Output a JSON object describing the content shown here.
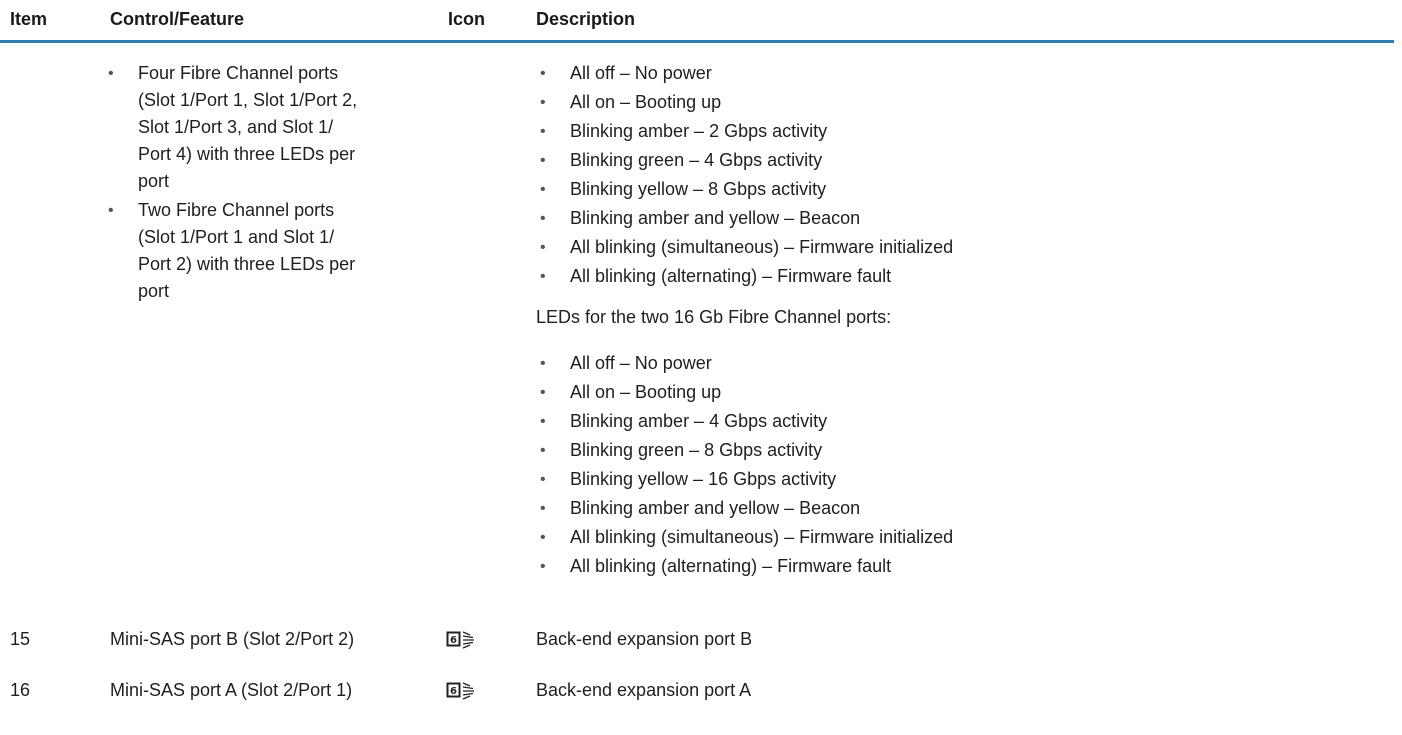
{
  "header": {
    "item": "Item",
    "control": "Control/Feature",
    "icon": "Icon",
    "description": "Description"
  },
  "control_list": [
    "Four Fibre Channel ports",
    "(Slot 1/Port 1, Slot 1/Port 2,",
    "Slot 1/Port 3, and Slot 1/",
    "Port 4) with three LEDs per",
    "port",
    "Two Fibre Channel ports",
    "(Slot 1/Port 1 and Slot 1/",
    "Port 2) with three LEDs per",
    "port"
  ],
  "desc_list_1": [
    "All off – No power",
    "All on – Booting up",
    "Blinking amber – 2 Gbps activity",
    "Blinking green – 4 Gbps activity",
    "Blinking yellow – 8 Gbps activity",
    "Blinking amber and yellow – Beacon",
    "All blinking (simultaneous) – Firmware initialized",
    "All blinking (alternating) – Firmware fault"
  ],
  "desc_16gb_intro": "LEDs for the two 16 Gb Fibre Channel ports:",
  "desc_list_2": [
    "All off – No power",
    "All on – Booting up",
    "Blinking amber – 4 Gbps activity",
    "Blinking green – 8 Gbps activity",
    "Blinking yellow – 16 Gbps activity",
    "Blinking amber and yellow – Beacon",
    "All blinking (simultaneous) – Firmware initialized",
    "All blinking (alternating) – Firmware fault"
  ],
  "rows": [
    {
      "item": "15",
      "control": "Mini-SAS port B (Slot 2/Port 2)",
      "icon": "mini-sas-port-icon",
      "description": "Back-end expansion port B"
    },
    {
      "item": "16",
      "control": "Mini-SAS port A (Slot 2/Port 1)",
      "icon": "mini-sas-port-icon",
      "description": "Back-end expansion port A"
    }
  ],
  "bullet": "•",
  "colors": {
    "header_rule": "#2f7fb3"
  }
}
